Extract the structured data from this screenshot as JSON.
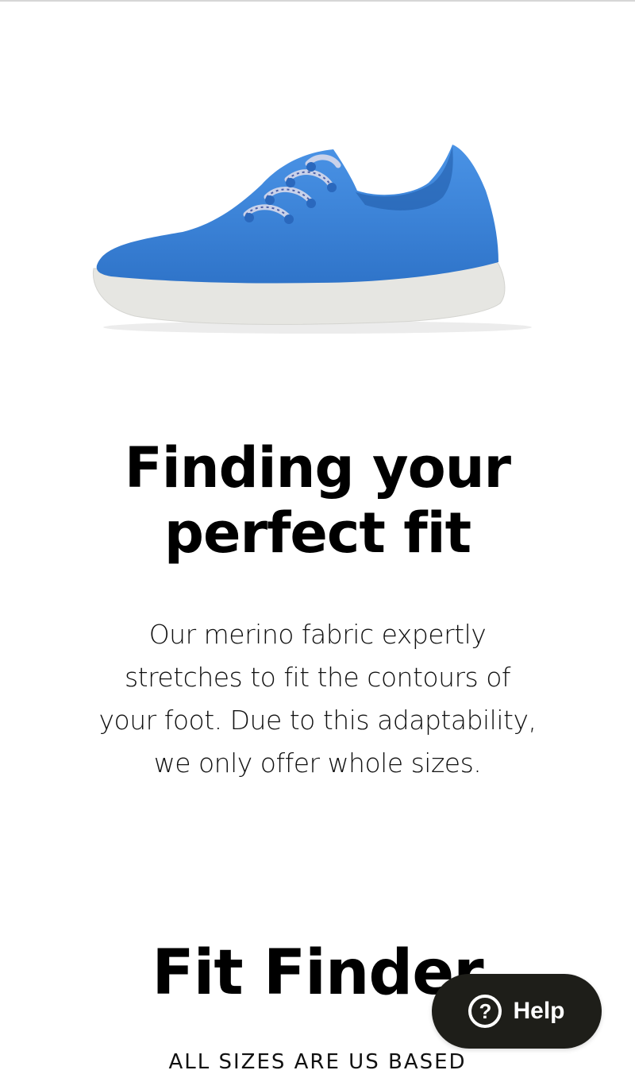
{
  "hero": {
    "image": "blue-wool-sneaker",
    "shoe_color": "#3d86db",
    "sole_color": "#e8e8e4"
  },
  "heading": {
    "line1": "Finding your",
    "line2": "perfect fit"
  },
  "description": {
    "line1": "Our merino fabric expertly",
    "line2": "stretches to fit the contours of",
    "line3": "your foot. Due to this adaptability,",
    "line4": "we only offer whole sizes."
  },
  "fit_finder": {
    "title": "Fit Finder",
    "note": "ALL SIZES ARE US BASED"
  },
  "help": {
    "label": "Help",
    "icon": "question-circle-icon",
    "bg_color": "#1e1e19"
  }
}
